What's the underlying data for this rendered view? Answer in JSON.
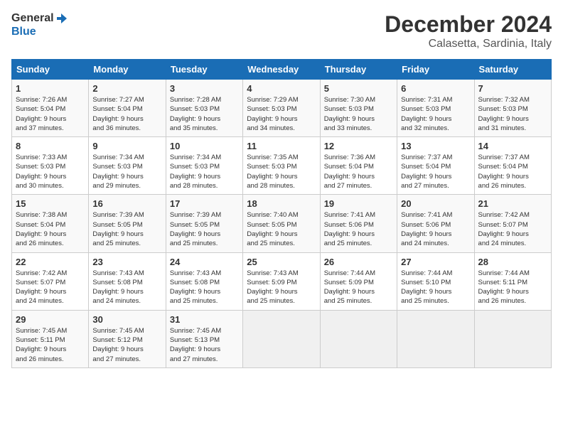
{
  "logo": {
    "line1": "General",
    "line2": "Blue"
  },
  "title": "December 2024",
  "location": "Calasetta, Sardinia, Italy",
  "days_of_week": [
    "Sunday",
    "Monday",
    "Tuesday",
    "Wednesday",
    "Thursday",
    "Friday",
    "Saturday"
  ],
  "weeks": [
    [
      {
        "day": "1",
        "info": "Sunrise: 7:26 AM\nSunset: 5:04 PM\nDaylight: 9 hours\nand 37 minutes."
      },
      {
        "day": "2",
        "info": "Sunrise: 7:27 AM\nSunset: 5:04 PM\nDaylight: 9 hours\nand 36 minutes."
      },
      {
        "day": "3",
        "info": "Sunrise: 7:28 AM\nSunset: 5:03 PM\nDaylight: 9 hours\nand 35 minutes."
      },
      {
        "day": "4",
        "info": "Sunrise: 7:29 AM\nSunset: 5:03 PM\nDaylight: 9 hours\nand 34 minutes."
      },
      {
        "day": "5",
        "info": "Sunrise: 7:30 AM\nSunset: 5:03 PM\nDaylight: 9 hours\nand 33 minutes."
      },
      {
        "day": "6",
        "info": "Sunrise: 7:31 AM\nSunset: 5:03 PM\nDaylight: 9 hours\nand 32 minutes."
      },
      {
        "day": "7",
        "info": "Sunrise: 7:32 AM\nSunset: 5:03 PM\nDaylight: 9 hours\nand 31 minutes."
      }
    ],
    [
      {
        "day": "8",
        "info": "Sunrise: 7:33 AM\nSunset: 5:03 PM\nDaylight: 9 hours\nand 30 minutes."
      },
      {
        "day": "9",
        "info": "Sunrise: 7:34 AM\nSunset: 5:03 PM\nDaylight: 9 hours\nand 29 minutes."
      },
      {
        "day": "10",
        "info": "Sunrise: 7:34 AM\nSunset: 5:03 PM\nDaylight: 9 hours\nand 28 minutes."
      },
      {
        "day": "11",
        "info": "Sunrise: 7:35 AM\nSunset: 5:03 PM\nDaylight: 9 hours\nand 28 minutes."
      },
      {
        "day": "12",
        "info": "Sunrise: 7:36 AM\nSunset: 5:04 PM\nDaylight: 9 hours\nand 27 minutes."
      },
      {
        "day": "13",
        "info": "Sunrise: 7:37 AM\nSunset: 5:04 PM\nDaylight: 9 hours\nand 27 minutes."
      },
      {
        "day": "14",
        "info": "Sunrise: 7:37 AM\nSunset: 5:04 PM\nDaylight: 9 hours\nand 26 minutes."
      }
    ],
    [
      {
        "day": "15",
        "info": "Sunrise: 7:38 AM\nSunset: 5:04 PM\nDaylight: 9 hours\nand 26 minutes."
      },
      {
        "day": "16",
        "info": "Sunrise: 7:39 AM\nSunset: 5:05 PM\nDaylight: 9 hours\nand 25 minutes."
      },
      {
        "day": "17",
        "info": "Sunrise: 7:39 AM\nSunset: 5:05 PM\nDaylight: 9 hours\nand 25 minutes."
      },
      {
        "day": "18",
        "info": "Sunrise: 7:40 AM\nSunset: 5:05 PM\nDaylight: 9 hours\nand 25 minutes."
      },
      {
        "day": "19",
        "info": "Sunrise: 7:41 AM\nSunset: 5:06 PM\nDaylight: 9 hours\nand 25 minutes."
      },
      {
        "day": "20",
        "info": "Sunrise: 7:41 AM\nSunset: 5:06 PM\nDaylight: 9 hours\nand 24 minutes."
      },
      {
        "day": "21",
        "info": "Sunrise: 7:42 AM\nSunset: 5:07 PM\nDaylight: 9 hours\nand 24 minutes."
      }
    ],
    [
      {
        "day": "22",
        "info": "Sunrise: 7:42 AM\nSunset: 5:07 PM\nDaylight: 9 hours\nand 24 minutes."
      },
      {
        "day": "23",
        "info": "Sunrise: 7:43 AM\nSunset: 5:08 PM\nDaylight: 9 hours\nand 24 minutes."
      },
      {
        "day": "24",
        "info": "Sunrise: 7:43 AM\nSunset: 5:08 PM\nDaylight: 9 hours\nand 25 minutes."
      },
      {
        "day": "25",
        "info": "Sunrise: 7:43 AM\nSunset: 5:09 PM\nDaylight: 9 hours\nand 25 minutes."
      },
      {
        "day": "26",
        "info": "Sunrise: 7:44 AM\nSunset: 5:09 PM\nDaylight: 9 hours\nand 25 minutes."
      },
      {
        "day": "27",
        "info": "Sunrise: 7:44 AM\nSunset: 5:10 PM\nDaylight: 9 hours\nand 25 minutes."
      },
      {
        "day": "28",
        "info": "Sunrise: 7:44 AM\nSunset: 5:11 PM\nDaylight: 9 hours\nand 26 minutes."
      }
    ],
    [
      {
        "day": "29",
        "info": "Sunrise: 7:45 AM\nSunset: 5:11 PM\nDaylight: 9 hours\nand 26 minutes."
      },
      {
        "day": "30",
        "info": "Sunrise: 7:45 AM\nSunset: 5:12 PM\nDaylight: 9 hours\nand 27 minutes."
      },
      {
        "day": "31",
        "info": "Sunrise: 7:45 AM\nSunset: 5:13 PM\nDaylight: 9 hours\nand 27 minutes."
      },
      {
        "day": "",
        "info": ""
      },
      {
        "day": "",
        "info": ""
      },
      {
        "day": "",
        "info": ""
      },
      {
        "day": "",
        "info": ""
      }
    ]
  ]
}
